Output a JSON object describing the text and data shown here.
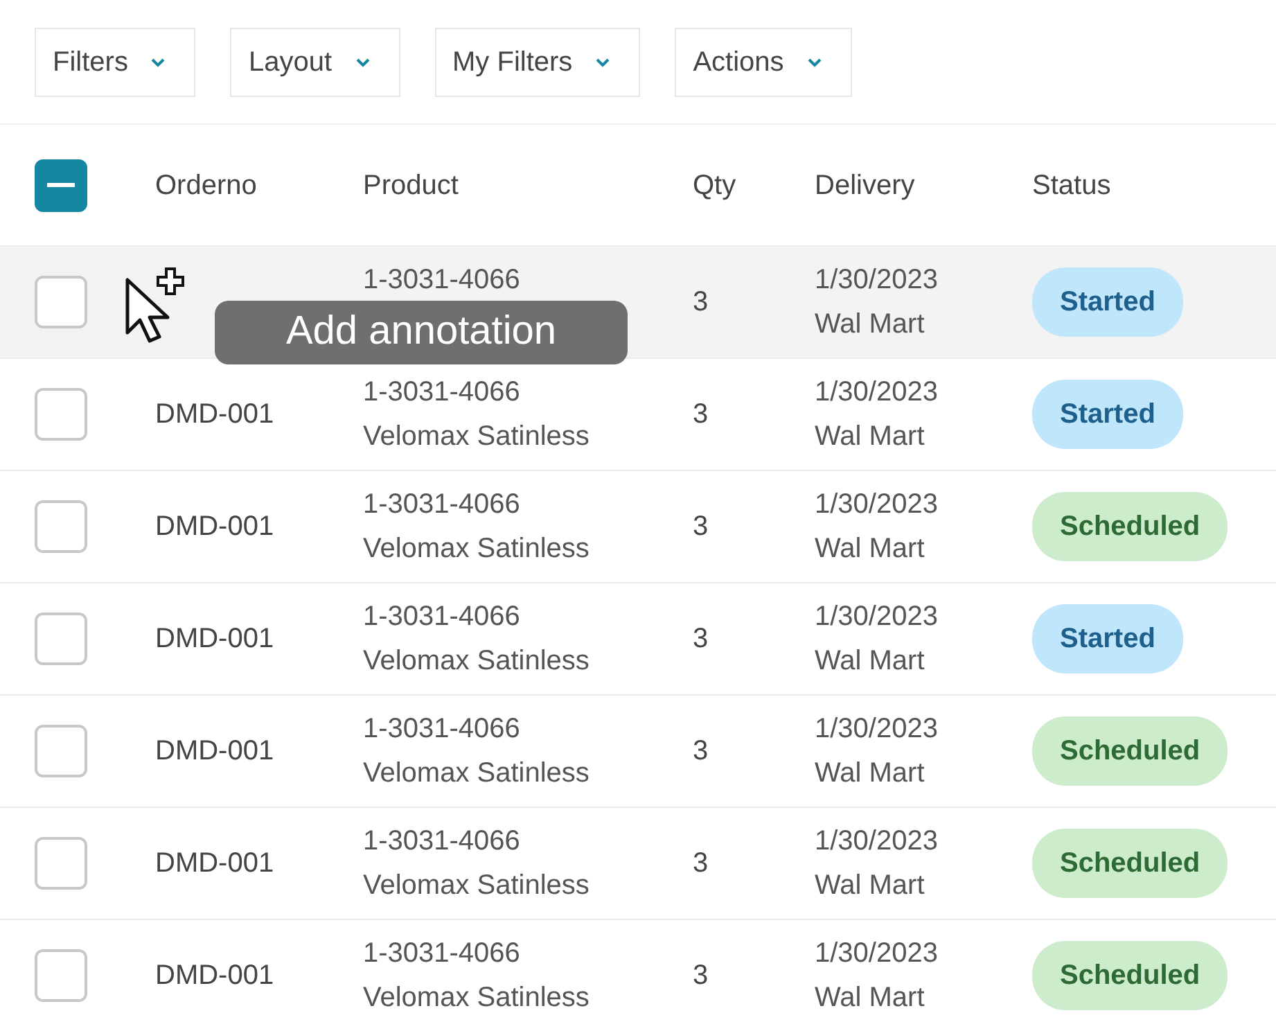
{
  "toolbar": {
    "dropdowns": [
      {
        "label": "Filters"
      },
      {
        "label": "Layout"
      },
      {
        "label": "My Filters"
      },
      {
        "label": "Actions"
      }
    ]
  },
  "table": {
    "select_all_indeterminate": true,
    "columns": [
      "Orderno",
      "Product",
      "Qty",
      "Delivery",
      "Status"
    ],
    "rows": [
      {
        "selected": true,
        "checked": false,
        "product_code": "1-3031-4066",
        "qty": "3",
        "date": "1/30/2023",
        "store": "Wal Mart",
        "status": "Started",
        "kind": "started"
      },
      {
        "selected": false,
        "checked": false,
        "orderno": "DMD-001",
        "product_code": "1-3031-4066",
        "product_name": "Velomax Satinless",
        "qty": "3",
        "date": "1/30/2023",
        "store": "Wal Mart",
        "status": "Started",
        "kind": "started"
      },
      {
        "selected": false,
        "checked": false,
        "orderno": "DMD-001",
        "product_code": "1-3031-4066",
        "product_name": "Velomax Satinless",
        "qty": "3",
        "date": "1/30/2023",
        "store": "Wal Mart",
        "status": "Scheduled",
        "kind": "scheduled"
      },
      {
        "selected": false,
        "checked": false,
        "orderno": "DMD-001",
        "product_code": "1-3031-4066",
        "product_name": "Velomax Satinless",
        "qty": "3",
        "date": "1/30/2023",
        "store": "Wal Mart",
        "status": "Started",
        "kind": "started"
      },
      {
        "selected": false,
        "checked": false,
        "orderno": "DMD-001",
        "product_code": "1-3031-4066",
        "product_name": "Velomax Satinless",
        "qty": "3",
        "date": "1/30/2023",
        "store": "Wal Mart",
        "status": "Scheduled",
        "kind": "scheduled"
      },
      {
        "selected": false,
        "checked": false,
        "orderno": "DMD-001",
        "product_code": "1-3031-4066",
        "product_name": "Velomax Satinless",
        "qty": "3",
        "date": "1/30/2023",
        "store": "Wal Mart",
        "status": "Scheduled",
        "kind": "scheduled"
      },
      {
        "selected": false,
        "checked": false,
        "orderno": "DMD-001",
        "product_code": "1-3031-4066",
        "product_name": "Velomax Satinless",
        "qty": "3",
        "date": "1/30/2023",
        "store": "Wal Mart",
        "status": "Scheduled",
        "kind": "scheduled"
      }
    ]
  },
  "tooltip": {
    "text": "Add annotation"
  }
}
